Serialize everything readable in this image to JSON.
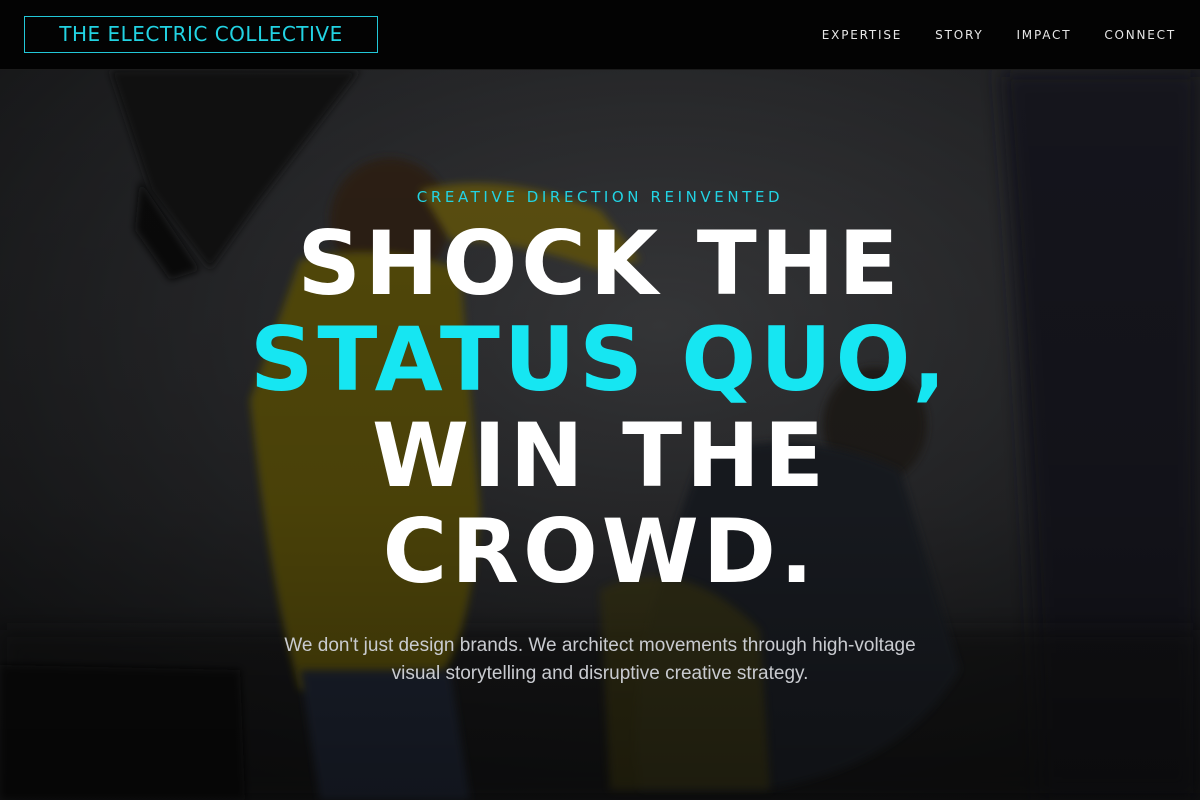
{
  "header": {
    "logo_text": "THE ELECTRIC COLLECTIVE",
    "nav": [
      {
        "label": "EXPERTISE"
      },
      {
        "label": "STORY"
      },
      {
        "label": "IMPACT"
      },
      {
        "label": "CONNECT"
      }
    ]
  },
  "hero": {
    "eyebrow": "CREATIVE DIRECTION REINVENTED",
    "headline": {
      "line1": "SHOCK THE",
      "line2": "STATUS QUO,",
      "line3": "WIN THE",
      "line4": "CROWD."
    },
    "subcopy": "We don't just design brands. We architect movements through high-voltage visual storytelling and disruptive creative strategy."
  },
  "colors": {
    "accent": "#16e6f2",
    "background": "#000000",
    "text": "#ffffff"
  }
}
